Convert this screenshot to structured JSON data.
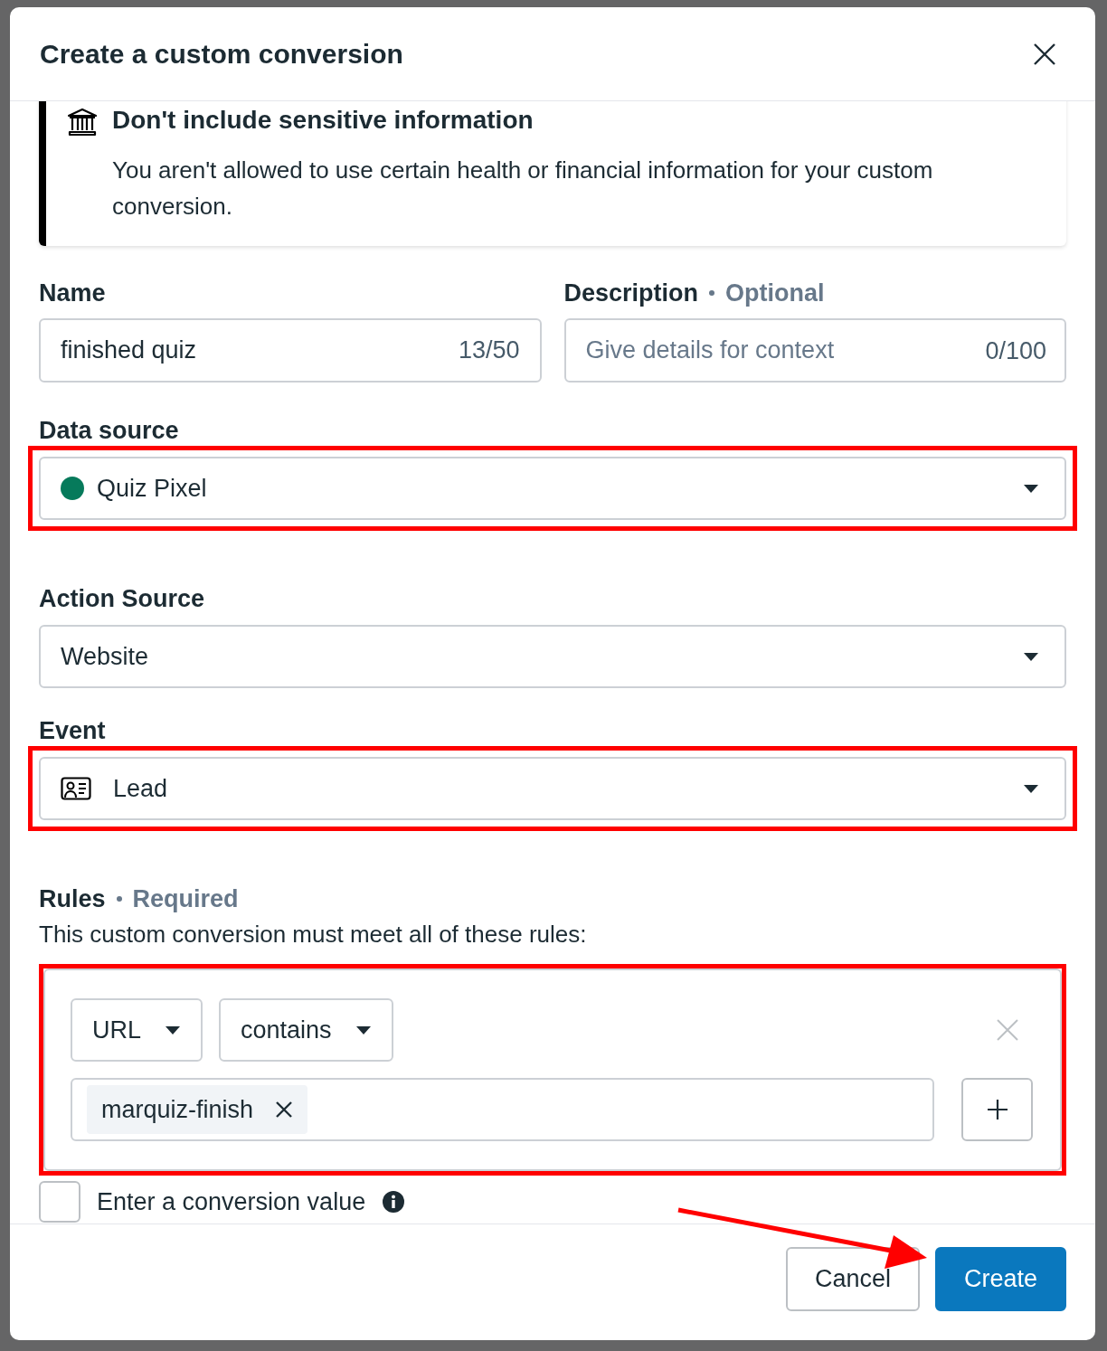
{
  "dialog": {
    "title": "Create a custom conversion"
  },
  "notice": {
    "title": "Don't include sensitive information",
    "text": "You aren't allowed to use certain health or financial information for your custom conversion."
  },
  "name": {
    "label": "Name",
    "value": "finished quiz",
    "counter": "13/50"
  },
  "description": {
    "label": "Description",
    "note": "Optional",
    "placeholder": "Give details for context",
    "counter": "0/100"
  },
  "data_source": {
    "label": "Data source",
    "value": "Quiz Pixel",
    "color": "#067a5b",
    "highlighted": true
  },
  "action_source": {
    "label": "Action Source",
    "value": "Website",
    "highlighted": false
  },
  "event": {
    "label": "Event",
    "value": "Lead",
    "highlighted": true
  },
  "rules": {
    "label": "Rules",
    "note": "Required",
    "text": "This custom conversion must meet all of these rules:",
    "highlighted": true,
    "field": "URL",
    "operator": "contains",
    "values": [
      "marquiz-finish"
    ]
  },
  "conversion_value": {
    "label": "Enter a conversion value",
    "checked": false
  },
  "buttons": [
    {
      "label": "Cancel",
      "kind": "secondary"
    },
    {
      "label": "Create",
      "kind": "primary"
    }
  ],
  "annotation_arrow": true
}
